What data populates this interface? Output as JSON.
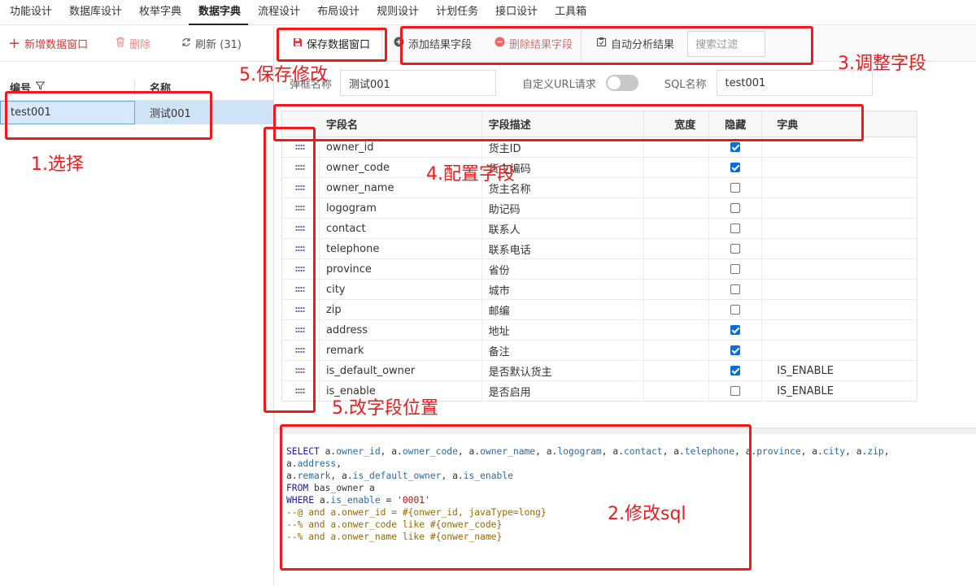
{
  "topnav": {
    "items": [
      "功能设计",
      "数据库设计",
      "枚举字典",
      "数据字典",
      "流程设计",
      "布局设计",
      "规则设计",
      "计划任务",
      "接口设计",
      "工具箱"
    ],
    "active_index": 3
  },
  "left": {
    "toolbar": {
      "add": "新增数据窗口",
      "delete": "删除",
      "refresh": "刷新 (31)"
    },
    "columns": {
      "code": "编号",
      "name": "名称"
    },
    "rows": [
      {
        "code": "test001",
        "name": "测试001"
      }
    ]
  },
  "right": {
    "toolbar": {
      "save": "保存数据窗口",
      "add_field": "添加结果字段",
      "remove_field": "删除结果字段",
      "auto_analyze": "自动分析结果",
      "search_placeholder": "搜索过滤"
    },
    "form": {
      "popup_name_label": "弹框名称",
      "popup_name_value": "测试001",
      "custom_url_label": "自定义URL请求",
      "custom_url_on": false,
      "sql_name_label": "SQL名称",
      "sql_name_value": "test001"
    },
    "grid": {
      "columns": {
        "name": "字段名",
        "desc": "字段描述",
        "width": "宽度",
        "hidden": "隐藏",
        "dict": "字典"
      },
      "rows": [
        {
          "name": "owner_id",
          "desc": "货主ID",
          "hidden": true,
          "dict": ""
        },
        {
          "name": "owner_code",
          "desc": "货主编码",
          "hidden": true,
          "dict": ""
        },
        {
          "name": "owner_name",
          "desc": "货主名称",
          "hidden": false,
          "dict": ""
        },
        {
          "name": "logogram",
          "desc": "助记码",
          "hidden": false,
          "dict": ""
        },
        {
          "name": "contact",
          "desc": "联系人",
          "hidden": false,
          "dict": ""
        },
        {
          "name": "telephone",
          "desc": "联系电话",
          "hidden": false,
          "dict": ""
        },
        {
          "name": "province",
          "desc": "省份",
          "hidden": false,
          "dict": ""
        },
        {
          "name": "city",
          "desc": "城市",
          "hidden": false,
          "dict": ""
        },
        {
          "name": "zip",
          "desc": "邮编",
          "hidden": false,
          "dict": ""
        },
        {
          "name": "address",
          "desc": "地址",
          "hidden": true,
          "dict": ""
        },
        {
          "name": "remark",
          "desc": "备注",
          "hidden": true,
          "dict": ""
        },
        {
          "name": "is_default_owner",
          "desc": "是否默认货主",
          "hidden": true,
          "dict": "IS_ENABLE"
        },
        {
          "name": "is_enable",
          "desc": "是否启用",
          "hidden": false,
          "dict": "IS_ENABLE"
        }
      ]
    },
    "sql_lines": [
      [
        [
          "kw",
          "SELECT "
        ],
        [
          "tx",
          "a."
        ],
        [
          "fld",
          "owner_id"
        ],
        [
          "tx",
          ", a."
        ],
        [
          "fld",
          "owner_code"
        ],
        [
          "tx",
          ", a."
        ],
        [
          "fld",
          "owner_name"
        ],
        [
          "tx",
          ", a."
        ],
        [
          "fld",
          "logogram"
        ],
        [
          "tx",
          ", a."
        ],
        [
          "fld",
          "contact"
        ],
        [
          "tx",
          ", a."
        ],
        [
          "fld",
          "telephone"
        ],
        [
          "tx",
          ", a."
        ],
        [
          "fld",
          "province"
        ],
        [
          "tx",
          ", a."
        ],
        [
          "fld",
          "city"
        ],
        [
          "tx",
          ", a."
        ],
        [
          "fld",
          "zip"
        ],
        [
          "tx",
          ","
        ]
      ],
      [
        [
          "tx",
          "a."
        ],
        [
          "fld",
          "address"
        ],
        [
          "tx",
          ","
        ]
      ],
      [
        [
          "tx",
          "a."
        ],
        [
          "fld",
          "remark"
        ],
        [
          "tx",
          ", a."
        ],
        [
          "fld",
          "is_default_owner"
        ],
        [
          "tx",
          ", a."
        ],
        [
          "fld",
          "is_enable"
        ]
      ],
      [
        [
          "kw",
          "FROM "
        ],
        [
          "tx",
          "bas_owner a"
        ]
      ],
      [
        [
          "kw",
          "WHERE "
        ],
        [
          "tx",
          "a."
        ],
        [
          "fld",
          "is_enable"
        ],
        [
          "tx",
          " = "
        ],
        [
          "str",
          "'0001'"
        ]
      ],
      [
        [
          "cm",
          "--@ and a.onwer_id = #{onwer_id, javaType=long}"
        ]
      ],
      [
        [
          "cm",
          "--% and a.onwer_code like #{onwer_code}"
        ]
      ],
      [
        [
          "cm",
          "--% and a.onwer_name like #{onwer_name}"
        ]
      ]
    ]
  },
  "annotations": {
    "step1": "1.选择",
    "step2": "2.修改sql",
    "step3": "3.调整字段",
    "step4": "4.配置字段",
    "step5a": "5.保存修改",
    "step5b": "5.改字段位置"
  },
  "colors": {
    "annotation": "#f01a1a",
    "selection": "#cfe3f7",
    "checkbox": "#0b6ed6",
    "danger": "#d9383a"
  }
}
